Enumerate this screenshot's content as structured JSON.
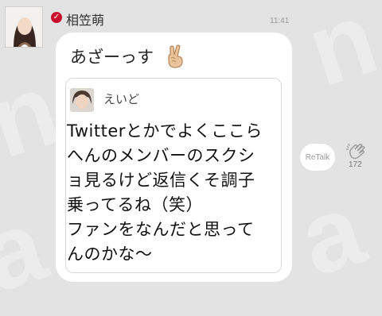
{
  "post": {
    "author": "相笠萌",
    "time": "11:41",
    "message": "あざーっす",
    "emoji_icon": "victory-hand-icon",
    "verified_icon": "checkmark-badge-icon"
  },
  "quoted": {
    "author": "えいど",
    "text": "Twitterとかでよくここら\nへんのメンバーのスクシ\nョ見るけど返信くそ調子\n乗ってるね（笑）\nファンをなんだと思って\nんのかな〜"
  },
  "actions": {
    "retalk_label": "ReTalk",
    "clap_count": "172",
    "clap_icon": "clap-icon"
  },
  "colors": {
    "background": "#e3e3e3",
    "bubble": "#ffffff",
    "verified": "#c8102e"
  }
}
